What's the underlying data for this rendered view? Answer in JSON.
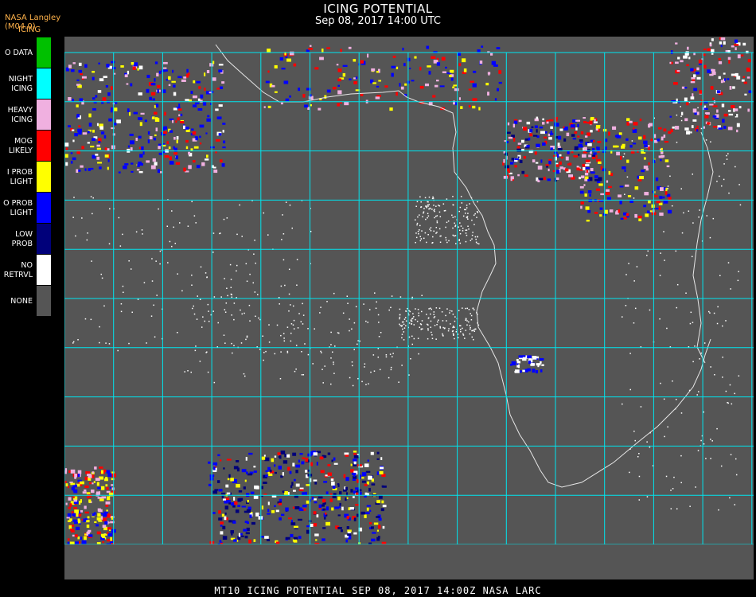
{
  "header": {
    "title": "ICING POTENTIAL",
    "subtitle": "Sep 08, 2017 14:00 UTC",
    "producer": "NASA Langley (M04.0)",
    "legend_title": "ICING"
  },
  "legend": [
    {
      "label": "O DATA",
      "color": "#00c000"
    },
    {
      "label": "NIGHT\nICING",
      "color": "#00ffff"
    },
    {
      "label": "HEAVY\nICING",
      "color": "#f0b0e0"
    },
    {
      "label": "MOG\nLIKELY",
      "color": "#ff0000"
    },
    {
      "label": "I PROB\nLIGHT",
      "color": "#ffff00"
    },
    {
      "label": "O PROB\nLIGHT",
      "color": "#0000ff"
    },
    {
      "label": "LOW\nPROB",
      "color": "#00007a"
    },
    {
      "label": "NO\nRETRVL",
      "color": "#ffffff"
    },
    {
      "label": "NONE",
      "color": "#555555"
    }
  ],
  "colors": {
    "background": "#555555",
    "grid": "#00e5ee",
    "coast": "#e6e6e6",
    "label": "#e03030"
  },
  "footer": "MT10  ICING POTENTIAL   SEP 08, 2017 14:00Z   NASA LARC"
}
